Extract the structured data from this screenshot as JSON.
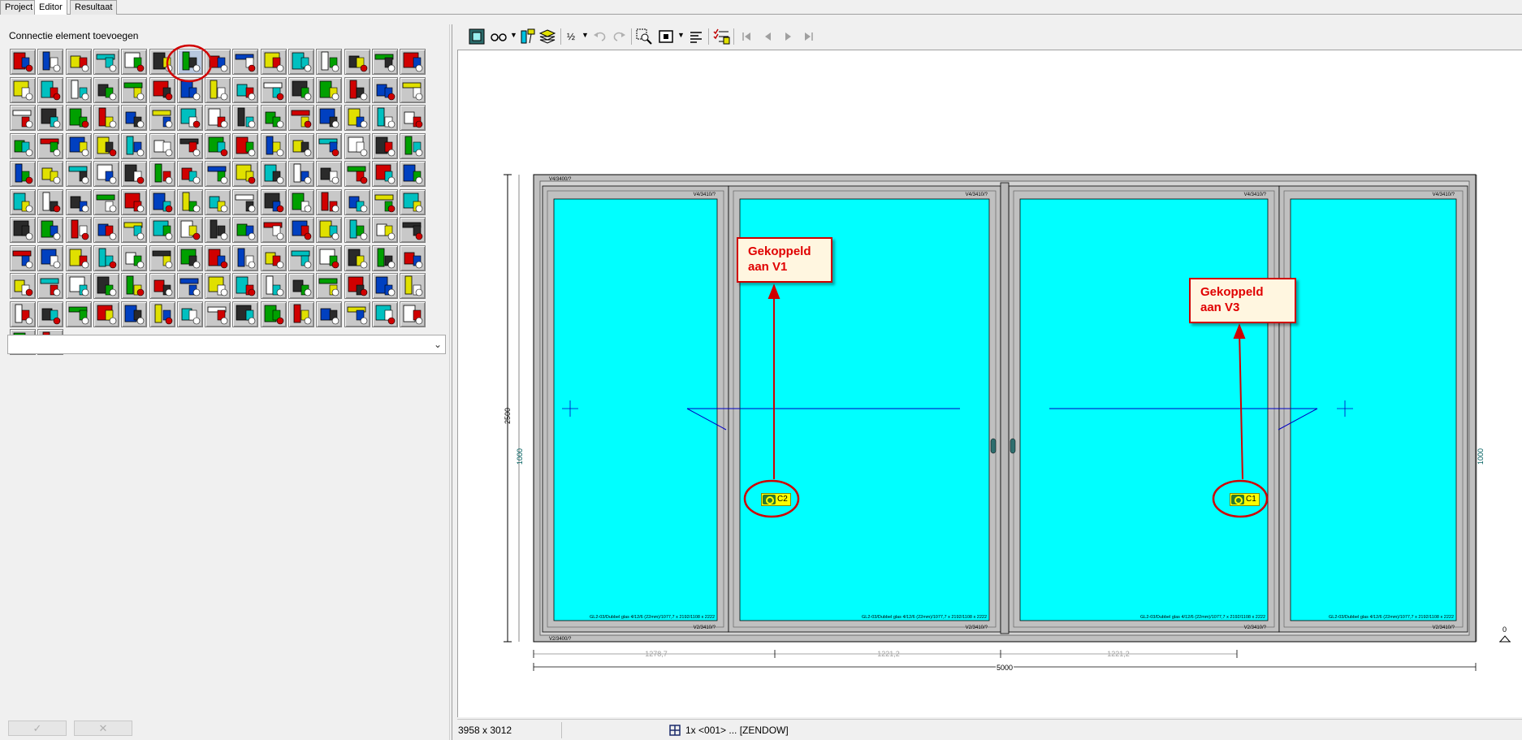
{
  "tabs": [
    {
      "label": "Project",
      "active": false
    },
    {
      "label": "Editor",
      "active": true
    },
    {
      "label": "Resultaat",
      "active": false
    }
  ],
  "left_panel": {
    "title": "Connectie element toevoegen",
    "tool_rows": [
      15,
      15,
      15,
      15,
      15,
      15,
      15,
      15,
      15,
      15,
      2
    ],
    "selected_tool_index": 6,
    "combo_value": "",
    "bottom_buttons": [
      {
        "name": "confirm-button",
        "icon": "check-icon"
      },
      {
        "name": "cancel-button",
        "icon": "cross-icon"
      }
    ]
  },
  "toolbar": {
    "icons": [
      "view-frame-icon",
      "glasses-icon",
      "paint-icon",
      "layers-icon",
      "half-icon",
      "undo-icon",
      "redo-icon",
      "zoom-icon",
      "frame-select-icon",
      "align-icon",
      "checklist-icon",
      "first-icon",
      "prev-icon",
      "next-icon",
      "last-icon"
    ]
  },
  "drawing": {
    "height_total": "2500",
    "height_handle_left": "1000",
    "height_handle_right": "1000",
    "right_zero": "0",
    "width_total": "5000",
    "width_segments": [
      "1278,7",
      "1221,2",
      "1221,2"
    ],
    "frame_label_top": "V4/3400/?",
    "frame_label_bottom": "V2/3400/?",
    "sash_top_labels": [
      "V4/3410/?",
      "V4/3410/?",
      "V4/3410/?",
      "V4/3410/?"
    ],
    "sash_bottom_labels": [
      "V2/3410/?",
      "V2/3410/?",
      "V2/3410/?",
      "V2/3410/?"
    ],
    "glass_labels": [
      "GL2-03/Dubbel glas 4/12/6 (22mm)/1077,7 x 2192/1108 x 2222",
      "GL2-03/Dubbel glas 4/12/6 (22mm)/1077,7 x 2192/1108 x 2222",
      "GL2-03/Dubbel glas 4/12/6 (22mm)/1077,7 x 2192/1108 x 2222",
      "GL2-03/Dubbel glas 4/12/6 (22mm)/1077,7 x 2192/1108 x 2222"
    ],
    "glass_color": "#00ffff",
    "frame_color": "#c0c0c0",
    "connectors": [
      "C2",
      "C1"
    ]
  },
  "annotations": {
    "callout_1": "Gekoppeld\naan V1",
    "callout_2": "Gekoppeld\naan V3",
    "accent_color": "#d00000"
  },
  "status": {
    "size": "3958 x 3012",
    "info": "1x <001> ... [ZENDOW]"
  }
}
